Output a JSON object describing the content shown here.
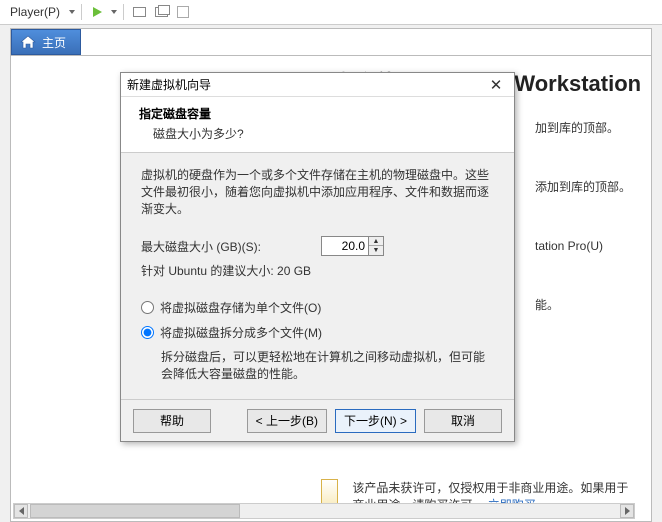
{
  "toolbar": {
    "player_label": "Player(P)"
  },
  "tab": {
    "home_label": "主页"
  },
  "welcome_title": "欢迎使用 VMware Workstation",
  "background_hints": {
    "line1": "加到库的顶部。",
    "line2": "添加到库的顶部。",
    "line3": "tation Pro(U)",
    "line4": "能。"
  },
  "footer_note": {
    "text1": "该产品未获许可，仅授权用于非商业用途。如果用于商业用途，请购买许可。",
    "link": "立即购买。"
  },
  "dialog": {
    "title": "新建虚拟机向导",
    "header_title": "指定磁盘容量",
    "header_sub": "磁盘大小为多少?",
    "desc": "虚拟机的硬盘作为一个或多个文件存储在主机的物理磁盘中。这些文件最初很小，随着您向虚拟机中添加应用程序、文件和数据而逐渐变大。",
    "size_label": "最大磁盘大小 (GB)(S):",
    "size_value": "20.0",
    "recommendation": "针对 Ubuntu 的建议大小: 20 GB",
    "radio_single": "将虚拟磁盘存储为单个文件(O)",
    "radio_split": "将虚拟磁盘拆分成多个文件(M)",
    "split_note": "拆分磁盘后，可以更轻松地在计算机之间移动虚拟机，但可能会降低大容量磁盘的性能。",
    "buttons": {
      "help": "帮助",
      "back": "< 上一步(B)",
      "next": "下一步(N) >",
      "cancel": "取消"
    }
  }
}
